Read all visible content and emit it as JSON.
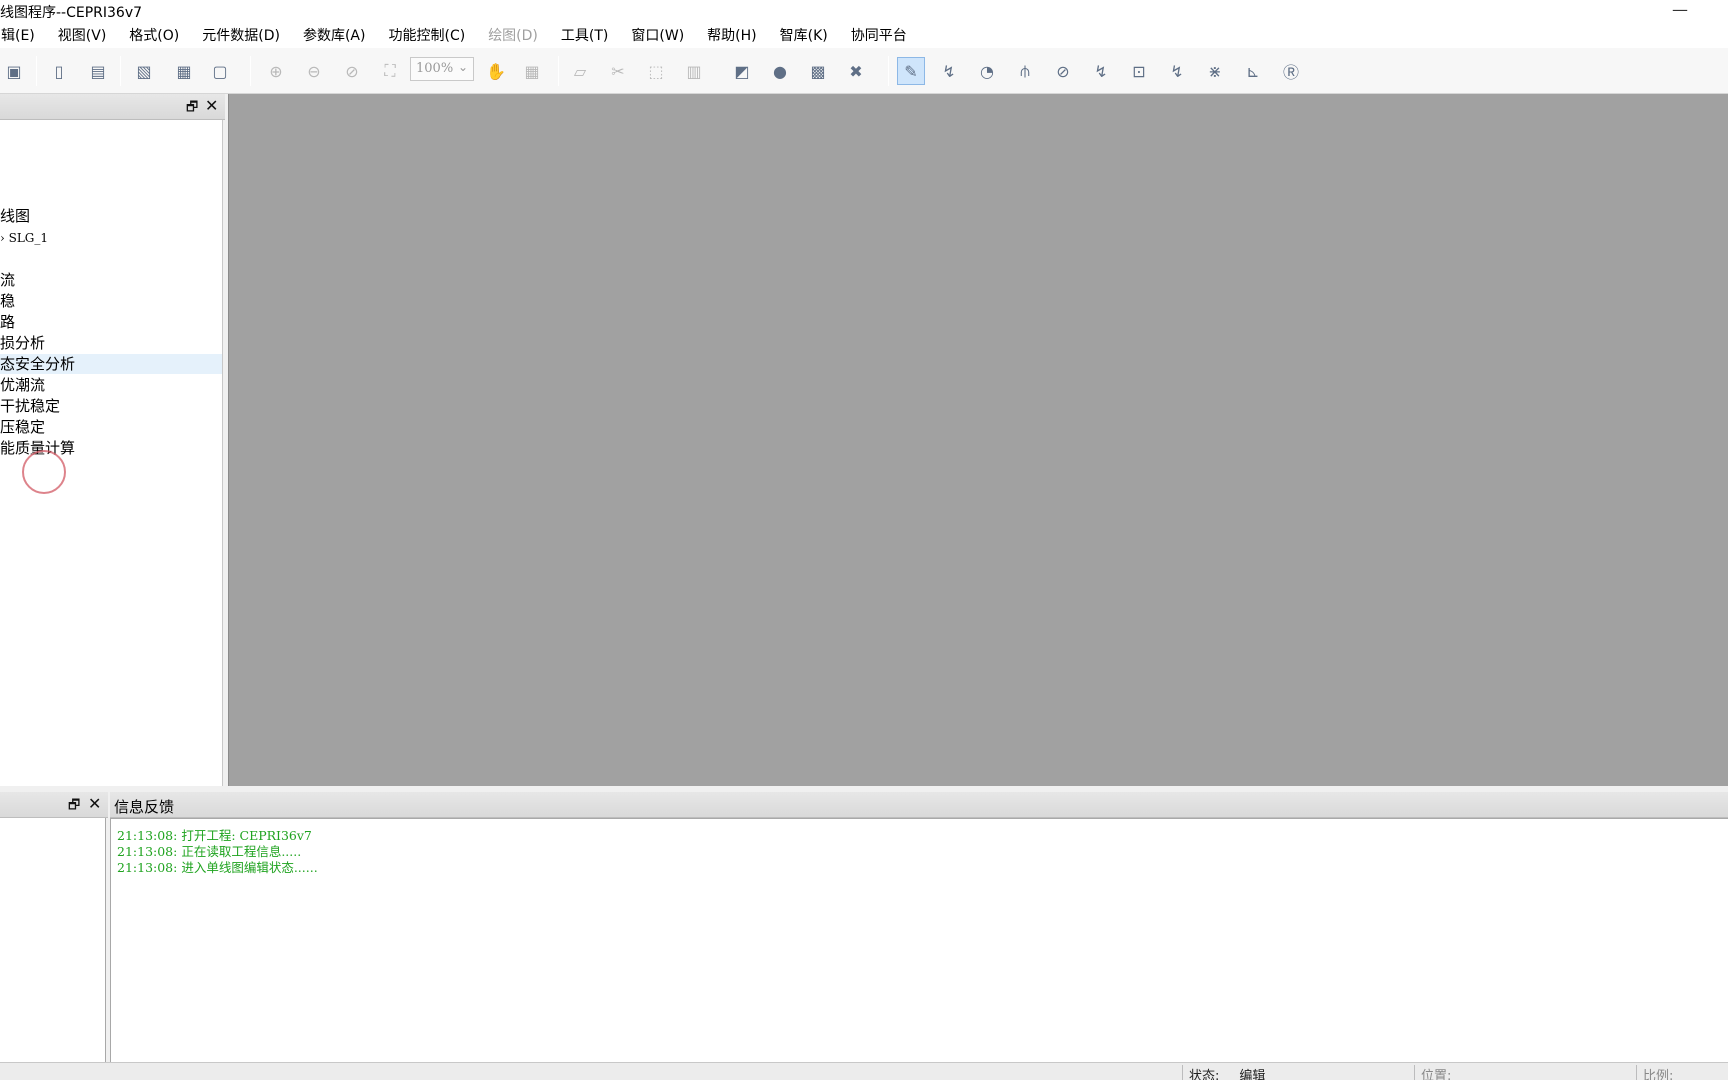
{
  "window": {
    "title": "线图程序--CEPRI36v7",
    "minimize_glyph": "—"
  },
  "menu": [
    {
      "label": "辑(E)",
      "enabled": true
    },
    {
      "label": "视图(V)",
      "enabled": true
    },
    {
      "label": "格式(O)",
      "enabled": true
    },
    {
      "label": "元件数据(D)",
      "enabled": true
    },
    {
      "label": "参数库(A)",
      "enabled": true
    },
    {
      "label": "功能控制(C)",
      "enabled": true
    },
    {
      "label": "绘图(D)",
      "enabled": false
    },
    {
      "label": "工具(T)",
      "enabled": true
    },
    {
      "label": "窗口(W)",
      "enabled": true
    },
    {
      "label": "帮助(H)",
      "enabled": true
    },
    {
      "label": "智库(K)",
      "enabled": true
    },
    {
      "label": "协同平台",
      "enabled": true
    }
  ],
  "toolbar": {
    "zoom_value": "100%",
    "icons": [
      {
        "name": "save-icon",
        "glyph": "▣",
        "enabled": true
      },
      {
        "name": "new-file-icon",
        "glyph": "▯",
        "enabled": true
      },
      {
        "name": "open-file-icon",
        "glyph": "▤",
        "enabled": true
      },
      {
        "name": "print-preview-icon",
        "glyph": "▧",
        "enabled": true
      },
      {
        "name": "print-icon",
        "glyph": "▦",
        "enabled": true
      },
      {
        "name": "page-setup-icon",
        "glyph": "▢",
        "enabled": true
      },
      {
        "name": "zoom-in-icon",
        "glyph": "⊕",
        "enabled": false
      },
      {
        "name": "zoom-out-icon",
        "glyph": "⊖",
        "enabled": false
      },
      {
        "name": "zoom-window-icon",
        "glyph": "⊘",
        "enabled": false
      },
      {
        "name": "fit-view-icon",
        "glyph": "⛶",
        "enabled": false
      },
      {
        "name": "pan-hand-icon",
        "glyph": "✋",
        "enabled": false
      },
      {
        "name": "grid-icon",
        "glyph": "▦",
        "enabled": false
      },
      {
        "name": "eraser-icon",
        "glyph": "▱",
        "enabled": false
      },
      {
        "name": "cut-icon",
        "glyph": "✂",
        "enabled": false
      },
      {
        "name": "select-area-icon",
        "glyph": "⬚",
        "enabled": false
      },
      {
        "name": "table-icon",
        "glyph": "▥",
        "enabled": false
      },
      {
        "name": "network-icon",
        "glyph": "◩",
        "enabled": true
      },
      {
        "name": "globe-icon",
        "glyph": "●",
        "enabled": true
      },
      {
        "name": "image-icon",
        "glyph": "▩",
        "enabled": true
      },
      {
        "name": "excel-icon",
        "glyph": "✖",
        "enabled": true
      },
      {
        "name": "edit-mode-icon",
        "glyph": "✎",
        "enabled": true,
        "active": true
      },
      {
        "name": "power-flow-icon",
        "glyph": "↯",
        "enabled": true
      },
      {
        "name": "pie-analysis-icon",
        "glyph": "◔",
        "enabled": true
      },
      {
        "name": "short-circuit-icon",
        "glyph": "⫛",
        "enabled": true
      },
      {
        "name": "stability-icon",
        "glyph": "⊘",
        "enabled": true
      },
      {
        "name": "transient-icon",
        "glyph": "↯",
        "enabled": true
      },
      {
        "name": "calc-icon",
        "glyph": "⊡",
        "enabled": true
      },
      {
        "name": "fault-icon",
        "glyph": "↯",
        "enabled": true
      },
      {
        "name": "harmonic-icon",
        "glyph": "⋇",
        "enabled": true
      },
      {
        "name": "curve-icon",
        "glyph": "⊾",
        "enabled": true
      },
      {
        "name": "report-icon",
        "glyph": "Ⓡ",
        "enabled": true
      }
    ],
    "icon_color": "#5f6f86",
    "disabled_color": "#b9b9b9"
  },
  "tree": {
    "items": [
      {
        "label": "线图",
        "mono": false,
        "selected": false
      },
      {
        "label": "› SLG_1",
        "mono": true,
        "selected": false
      },
      {
        "label": "流",
        "mono": false,
        "selected": false
      },
      {
        "label": "稳",
        "mono": false,
        "selected": false
      },
      {
        "label": "路",
        "mono": false,
        "selected": false
      },
      {
        "label": "损分析",
        "mono": false,
        "selected": false
      },
      {
        "label": "态安全分析",
        "mono": false,
        "selected": true
      },
      {
        "label": "优潮流",
        "mono": false,
        "selected": false
      },
      {
        "label": "干扰稳定",
        "mono": false,
        "selected": false
      },
      {
        "label": "压稳定",
        "mono": false,
        "selected": false
      },
      {
        "label": "能质量计算",
        "mono": false,
        "selected": false
      }
    ],
    "pin_glyph": "🗗",
    "close_glyph": "✕"
  },
  "info": {
    "title": "信息反馈",
    "log_color": "#1fa31f",
    "lines": [
      "21:13:08: 打开工程: CEPRI36v7",
      "21:13:08: 正在读取工程信息.....",
      "21:13:08: 进入单线图编辑状态......"
    ]
  },
  "status": {
    "state_label": "状态:",
    "state_value": "编辑",
    "position_label": "位置:",
    "ratio_label": "比例:"
  }
}
